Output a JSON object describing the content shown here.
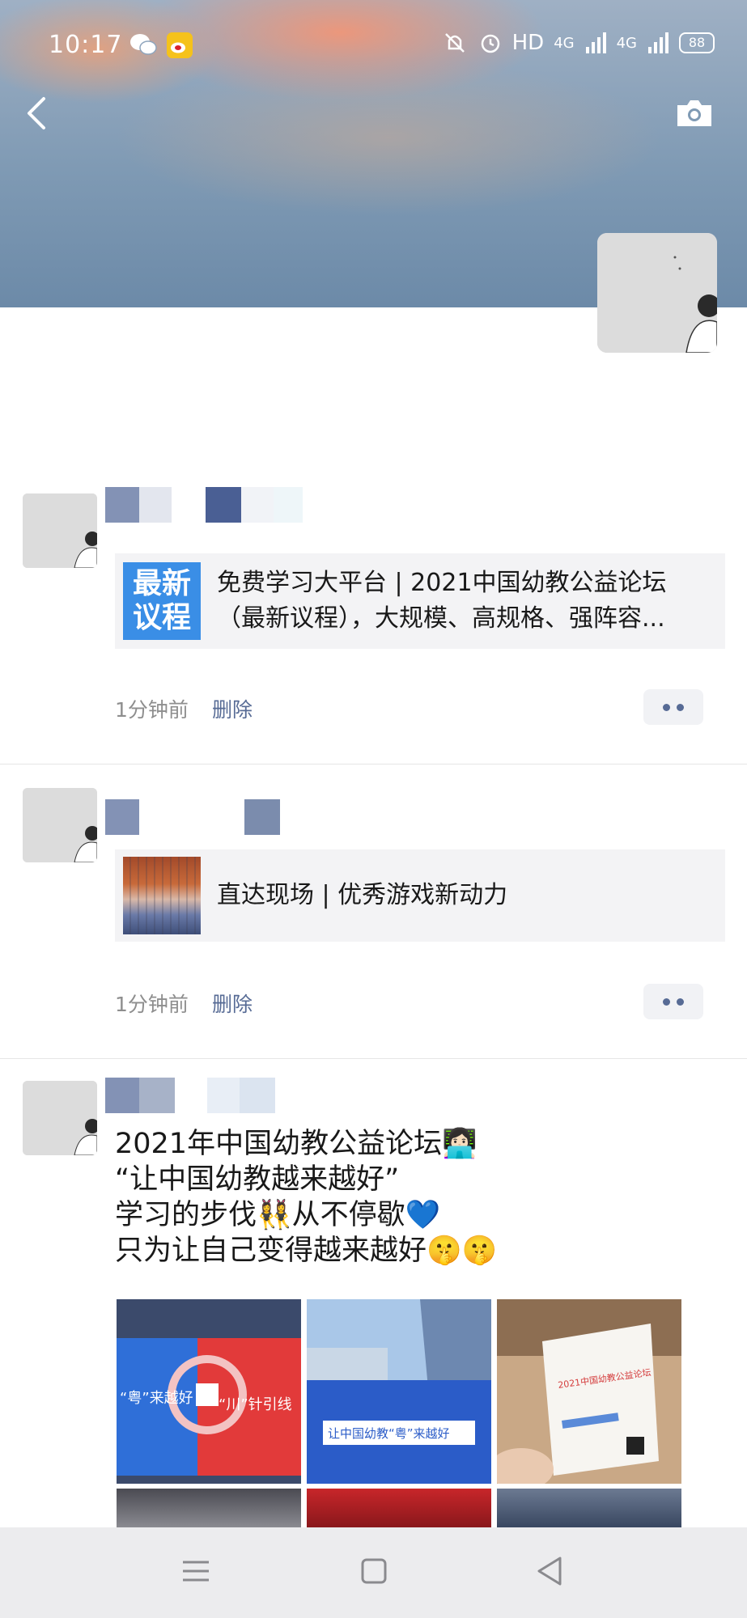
{
  "status_bar": {
    "time": "10:17",
    "network": "HD",
    "signal1": "4G",
    "signal2": "4G",
    "battery": "88",
    "icons": [
      "wechat-icon",
      "weibo-icon",
      "mute-icon",
      "alarm-icon",
      "signal-icon",
      "battery-icon"
    ]
  },
  "header": {
    "back_icon": "chevron-left-icon",
    "camera_icon": "camera-icon"
  },
  "posts": [
    {
      "card": {
        "thumb_text_1": "最新",
        "thumb_text_2": "议程",
        "line1": "免费学习大平台 | 2021中国幼教公益论坛",
        "line2": "（最新议程），大规模、高规格、强阵容..."
      },
      "time": "1分钟前",
      "delete": "删除"
    },
    {
      "card": {
        "line1": "直达现场 | 优秀游戏新动力"
      },
      "time": "1分钟前",
      "delete": "删除"
    },
    {
      "text_lines": [
        "2021年中国幼教公益论坛👩🏻‍💻",
        "“让中国幼教越来越好”",
        "学习的步伐👯‍♀️从不停歇💙",
        "只为让自己变得越来越好🤫🤫"
      ],
      "photos": [
        {
          "label": "“粤”来越好",
          "alt_label": "“川”针引线"
        },
        {
          "label": "让中国幼教“粤”来越好"
        },
        {
          "label": "2021中国幼教公益论坛"
        }
      ]
    }
  ],
  "nav": {
    "menu_icon": "menu-icon",
    "home_icon": "home-square-icon",
    "back_icon": "back-triangle-icon"
  },
  "colors": {
    "link": "#576b95",
    "meta": "#8e8e8e",
    "card_bg": "#f3f3f5",
    "agenda_blue": "#3a8ee6"
  }
}
